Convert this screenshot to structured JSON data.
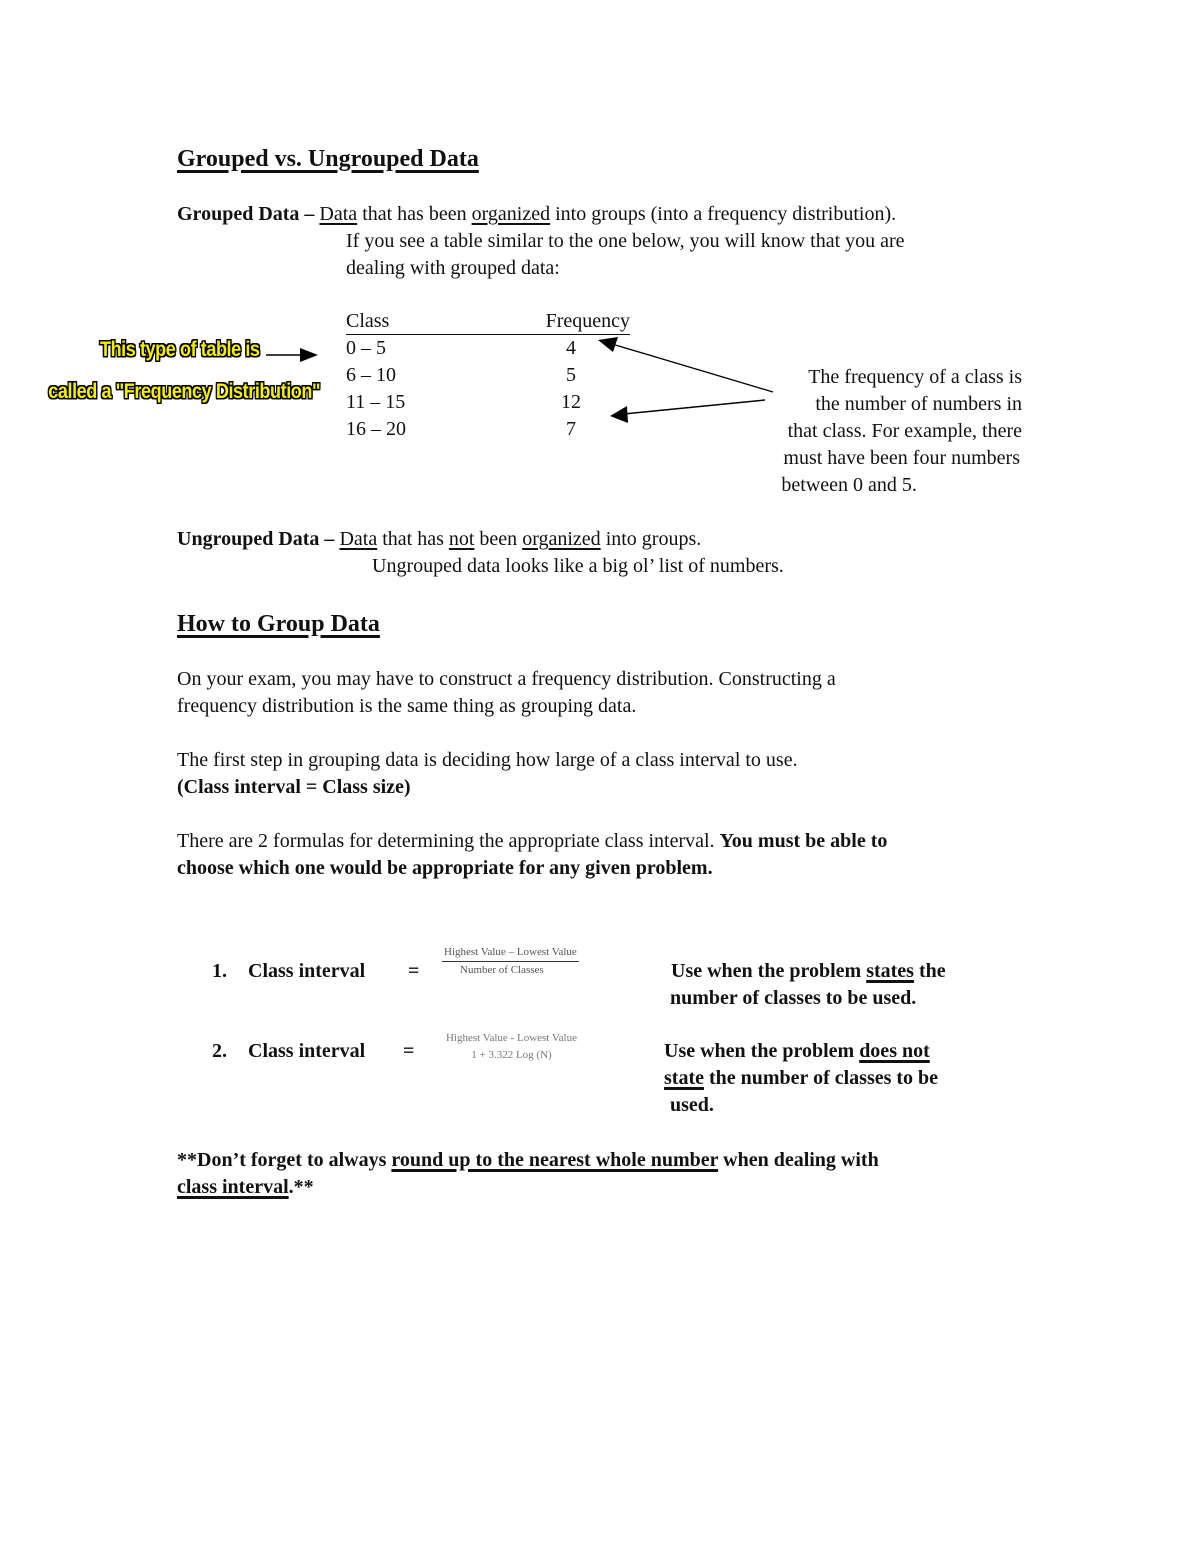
{
  "section1": {
    "title": "Grouped vs. Ungrouped Data",
    "grouped": {
      "term": "Grouped Data –",
      "def_part1": "Data",
      "def_part2": " that has been ",
      "def_part3": "organized",
      "def_part4": " into groups (into a frequency distribution).",
      "line2": "If you see a table similar to the one below, you will know that you are",
      "line3": "dealing with grouped data:"
    },
    "callout": {
      "line1": "This type of table is",
      "line2": "called a \"Frequency Distribution\"",
      "text_color": "#f5f000",
      "outline_color": "#000000"
    },
    "table": {
      "headers": [
        "Class",
        "Frequency"
      ],
      "rows": [
        {
          "class": "0 – 5",
          "frequency": "4"
        },
        {
          "class": "6 – 10",
          "frequency": "5"
        },
        {
          "class": "11 – 15",
          "frequency": "12"
        },
        {
          "class": "16 – 20",
          "frequency": "7"
        }
      ]
    },
    "note": {
      "lines": [
        "The frequency of a class is",
        "the number of numbers in",
        "that class. For example, there",
        "must have been four numbers",
        "between 0 and 5."
      ]
    },
    "ungrouped": {
      "term": "Ungrouped Data –",
      "p1": "Data",
      "p2": " that has ",
      "p3": "not",
      "p4": " been ",
      "p5": "organized",
      "p6": " into groups.",
      "line2": "Ungrouped data looks like a big ol’ list of numbers."
    }
  },
  "section2": {
    "title": "How to Group Data",
    "para1_line1": "On your exam, you may have to construct a frequency distribution.  Constructing a",
    "para1_line2": "frequency distribution is the same thing as grouping data.",
    "para2_line1": "The first step in grouping data is deciding how large of a class interval to use.",
    "para2_line2": "(Class interval = Class size)",
    "para3_line1_normal": "There are 2 formulas for determining the appropriate class interval.  ",
    "para3_line1_bold": "You must be able to",
    "para3_line2": "choose which one would be appropriate for any given problem.",
    "formulas": [
      {
        "number": "1.",
        "label": "Class interval",
        "equals": "=",
        "numerator": "Highest Value – Lowest Value",
        "denominator": "Number of Classes",
        "use_p1": "Use when the problem ",
        "use_u1": "states",
        "use_p2": " the",
        "use_line2": "number of classes to be used."
      },
      {
        "number": "2.",
        "label": "Class interval",
        "equals": "=",
        "numerator": "Highest Value - Lowest Value",
        "denominator": "1 + 3.322 Log (N)",
        "use_p1": "Use when the problem ",
        "use_u1": "does not",
        "use_line2_u": "state",
        "use_line2_rest": " the number of classes to be",
        "use_line3": "used."
      }
    ],
    "reminder": {
      "p1": "**Don’t forget to always ",
      "u1": "round up to the nearest whole number",
      "p2": " when dealing with",
      "u2": "class interval",
      "p3": ".**"
    }
  }
}
